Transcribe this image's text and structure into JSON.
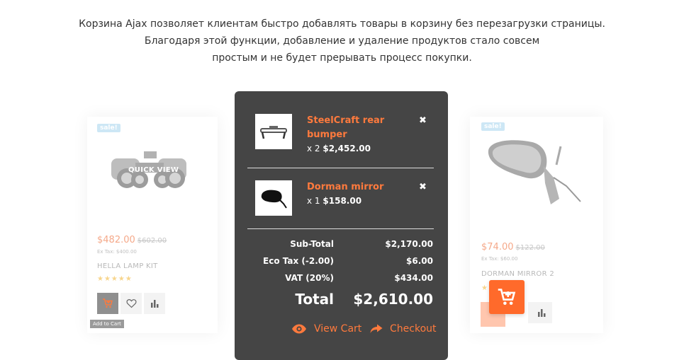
{
  "intro": {
    "line1": "Корзина Ajax позволяет клиентам быстро добавлять товары в корзину без перезагрузки страницы.",
    "line2": "Благодаря этой функции, добавление и удаление продуктов стало совсем",
    "line3": "простым и не будет прерывать процесс покупки."
  },
  "left_product": {
    "badge": "sale!",
    "quick_view": "QUICK VIEW",
    "price": "$482.00",
    "old_price": "$602.00",
    "ex_tax": "Ex Tax: $400.00",
    "name": "HELLA LAMP KIT",
    "stars": "★★★★★",
    "tooltip": "Add to Cart"
  },
  "right_product": {
    "badge": "sale!",
    "price": "$74.00",
    "old_price": "$122.00",
    "ex_tax": "Ex Tax: $60.00",
    "name": "DORMAN MIRROR 2",
    "stars": "★"
  },
  "cart": {
    "items": [
      {
        "name": "SteelCraft rear bumper",
        "qty": "x 2",
        "price": "$2,452.00",
        "icon": "bumper-thumbnail"
      },
      {
        "name": "Dorman mirror",
        "qty": "x 1",
        "price": "$158.00",
        "icon": "mirror-thumbnail"
      }
    ],
    "totals": [
      {
        "label": "Sub-Total",
        "value": "$2,170.00"
      },
      {
        "label": "Eco Tax (-2.00)",
        "value": "$6.00"
      },
      {
        "label": "VAT (20%)",
        "value": "$434.00"
      }
    ],
    "grand_total": {
      "label": "Total",
      "value": "$2,610.00"
    },
    "view_cart": "View Cart",
    "checkout": "Checkout"
  },
  "colors": {
    "accent": "#ff7a3d",
    "cart_bg": "#454545",
    "float_button": "#ff6a2b"
  }
}
